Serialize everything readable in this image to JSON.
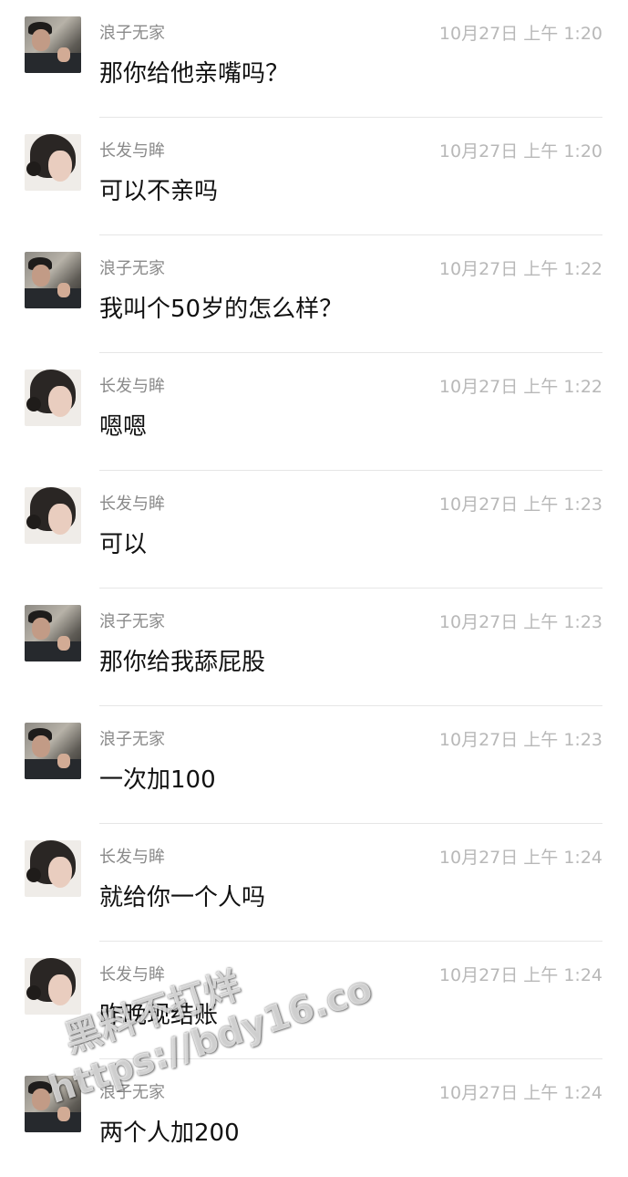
{
  "messages": [
    {
      "sender": "浪子无家",
      "time": "10月27日 上午 1:20",
      "text": "那你给他亲嘴吗？",
      "avatar": "male-avatar"
    },
    {
      "sender": "长发与眸",
      "time": "10月27日 上午 1:20",
      "text": "可以不亲吗",
      "avatar": "female-avatar"
    },
    {
      "sender": "浪子无家",
      "time": "10月27日 上午 1:22",
      "text": "我叫个50岁的怎么样？",
      "avatar": "male-avatar"
    },
    {
      "sender": "长发与眸",
      "time": "10月27日 上午 1:22",
      "text": "嗯嗯",
      "avatar": "female-avatar"
    },
    {
      "sender": "长发与眸",
      "time": "10月27日 上午 1:23",
      "text": "可以",
      "avatar": "female-avatar"
    },
    {
      "sender": "浪子无家",
      "time": "10月27日 上午 1:23",
      "text": "那你给我舔屁股",
      "avatar": "male-avatar"
    },
    {
      "sender": "浪子无家",
      "time": "10月27日 上午 1:23",
      "text": "一次加100",
      "avatar": "male-avatar"
    },
    {
      "sender": "长发与眸",
      "time": "10月27日 上午 1:24",
      "text": "就给你一个人吗",
      "avatar": "female-avatar"
    },
    {
      "sender": "长发与眸",
      "time": "10月27日 上午 1:24",
      "text": "昨晚现结账",
      "avatar": "female-avatar"
    },
    {
      "sender": "浪子无家",
      "time": "10月27日 上午 1:24",
      "text": "两个人加200",
      "avatar": "male-avatar"
    }
  ],
  "watermark": {
    "title": "黑料不打烊",
    "url": "https://bdy16.co"
  }
}
